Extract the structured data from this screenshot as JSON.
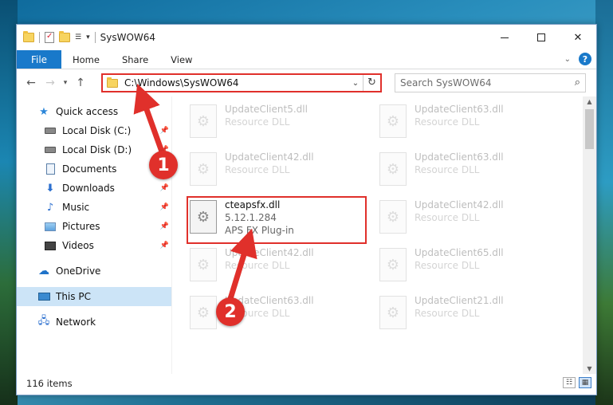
{
  "window": {
    "title": "SysWOW64",
    "qat_dropdown": "▾"
  },
  "ribbon": {
    "file": "File",
    "tabs": [
      "Home",
      "Share",
      "View"
    ],
    "help": "?"
  },
  "nav": {
    "back": "←",
    "forward": "→",
    "recent": "▾",
    "up": "↑",
    "address": "C:\\Windows\\SysWOW64",
    "search_placeholder": "Search SysWOW64"
  },
  "sidebar": {
    "items": [
      {
        "label": "Quick access",
        "icon": "star-icon",
        "pinned": false
      },
      {
        "label": "Local Disk (C:)",
        "icon": "disk-icon",
        "pinned": true
      },
      {
        "label": "Local Disk (D:)",
        "icon": "disk-icon",
        "pinned": true
      },
      {
        "label": "Documents",
        "icon": "documents-icon",
        "pinned": true
      },
      {
        "label": "Downloads",
        "icon": "downloads-icon",
        "pinned": true
      },
      {
        "label": "Music",
        "icon": "music-icon",
        "pinned": true
      },
      {
        "label": "Pictures",
        "icon": "pictures-icon",
        "pinned": true
      },
      {
        "label": "Videos",
        "icon": "videos-icon",
        "pinned": true
      },
      {
        "label": "OneDrive",
        "icon": "cloud-icon",
        "pinned": false
      },
      {
        "label": "This PC",
        "icon": "computer-icon",
        "pinned": false,
        "selected": true
      },
      {
        "label": "Network",
        "icon": "network-icon",
        "pinned": false
      }
    ]
  },
  "files": [
    {
      "name": "UpdateClient5.dll",
      "type": "Resource DLL"
    },
    {
      "name": "UpdateClient63.dll",
      "type": "Resource DLL"
    },
    {
      "name": "UpdateClient42.dll",
      "type": "Resource DLL"
    },
    {
      "name": "UpdateClient63.dll",
      "type": "Resource DLL"
    },
    {
      "name": "cteapsfx.dll",
      "version": "5.12.1.284",
      "type": "APS FX Plug-in",
      "highlighted": true
    },
    {
      "name": "UpdateClient42.dll",
      "type": "Resource DLL"
    },
    {
      "name": "UpdateClient42.dll",
      "type": "Resource DLL"
    },
    {
      "name": "UpdateClient65.dll",
      "type": "Resource DLL"
    },
    {
      "name": "UpdateClient63.dll",
      "type": "Resource DLL"
    },
    {
      "name": "UpdateClient21.dll",
      "type": "Resource DLL"
    }
  ],
  "status": {
    "item_count": "116 items"
  },
  "annotations": {
    "step1": "1",
    "step2": "2",
    "color": "#e0302b"
  }
}
